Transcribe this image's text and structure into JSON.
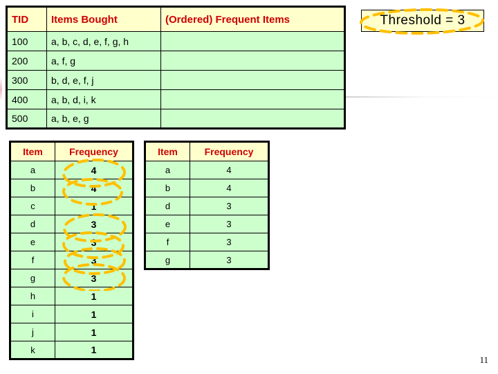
{
  "slide": {
    "number": "11"
  },
  "threshold": {
    "label": "Threshold = 3"
  },
  "transactions": {
    "headers": {
      "tid": "TID",
      "items_bought": "Items Bought",
      "frequent_items": "(Ordered) Frequent Items"
    },
    "rows": [
      {
        "tid": "100",
        "items": "a, b, c, d, e, f, g, h",
        "frequent": ""
      },
      {
        "tid": "200",
        "items": "a, f, g",
        "frequent": ""
      },
      {
        "tid": "300",
        "items": "b, d, e, f, j",
        "frequent": ""
      },
      {
        "tid": "400",
        "items": "a, b, d, i, k",
        "frequent": ""
      },
      {
        "tid": "500",
        "items": "a, b, e, g",
        "frequent": ""
      }
    ]
  },
  "frequency_all": {
    "headers": {
      "item": "Item",
      "frequency": "Frequency"
    },
    "rows": [
      {
        "item": "a",
        "frequency": "4"
      },
      {
        "item": "b",
        "frequency": "4"
      },
      {
        "item": "c",
        "frequency": "1"
      },
      {
        "item": "d",
        "frequency": "3"
      },
      {
        "item": "e",
        "frequency": "3"
      },
      {
        "item": "f",
        "frequency": "3"
      },
      {
        "item": "g",
        "frequency": "3"
      },
      {
        "item": "h",
        "frequency": "1"
      },
      {
        "item": "i",
        "frequency": "1"
      },
      {
        "item": "j",
        "frequency": "1"
      },
      {
        "item": "k",
        "frequency": "1"
      }
    ]
  },
  "frequency_frequent": {
    "headers": {
      "item": "Item",
      "frequency": "Frequency"
    },
    "rows": [
      {
        "item": "a",
        "frequency": "4"
      },
      {
        "item": "b",
        "frequency": "4"
      },
      {
        "item": "d",
        "frequency": "3"
      },
      {
        "item": "e",
        "frequency": "3"
      },
      {
        "item": "f",
        "frequency": "3"
      },
      {
        "item": "g",
        "frequency": "3"
      }
    ]
  },
  "annotations": {
    "highlight_color": "#ffc000",
    "circled_items": [
      "a",
      "b",
      "d",
      "e",
      "f",
      "g"
    ],
    "circled_threshold": true
  },
  "colors": {
    "header_fill": "#ffffcc",
    "header_text": "#cc0000",
    "cell_fill": "#ccffcc",
    "border": "#000000",
    "highlight": "#ffc000"
  }
}
